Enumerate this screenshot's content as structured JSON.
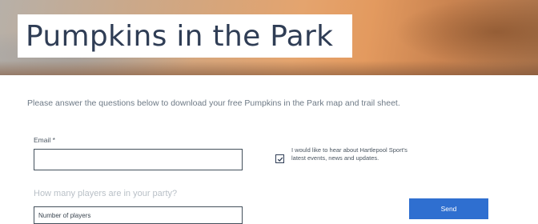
{
  "header": {
    "title": "Pumpkins in the Park"
  },
  "intro": {
    "text": "Please answer the questions below to download your free Pumpkins in the Park map and trail sheet."
  },
  "form": {
    "email_label": "Email *",
    "email_value": "",
    "consent_checked": true,
    "consent_text": "I would like to hear about Hartlepool Sport's latest events, news and updates.",
    "players_question": "How many players are in your party?",
    "players_placeholder": "Number of players",
    "send_label": "Send"
  },
  "colors": {
    "title": "#2f3d55",
    "send_button": "#2f6fd0",
    "intro_text": "#6e7a86"
  },
  "icons": {
    "checkbox": "check-icon"
  }
}
